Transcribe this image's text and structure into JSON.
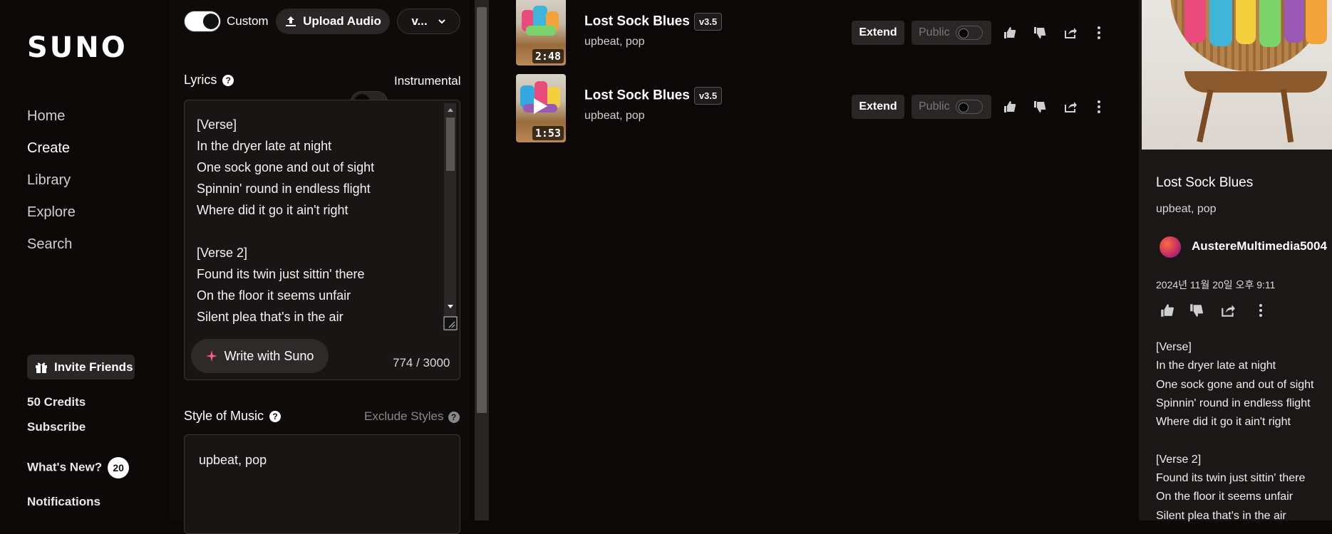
{
  "sidebar": {
    "logo": "SUNO",
    "nav": [
      "Home",
      "Create",
      "Library",
      "Explore",
      "Search"
    ],
    "invite_label": "Invite Friends",
    "credits": "50 Credits",
    "subscribe": "Subscribe",
    "whats_new": "What's New?",
    "whats_new_count": "20",
    "notifications": "Notifications"
  },
  "create": {
    "custom_label": "Custom",
    "upload_label": "Upload Audio",
    "version_label": "v...",
    "lyrics_label": "Lyrics",
    "instrumental_label": "Instrumental",
    "lyrics_text": "[Verse]\nIn the dryer late at night\nOne sock gone and out of sight\nSpinnin' round in endless flight\nWhere did it go it ain't right\n\n[Verse 2]\nFound its twin just sittin' there\nOn the floor it seems unfair\nSilent plea that's in the air",
    "write_label": "Write with Suno",
    "counter": "774 / 3000",
    "style_label": "Style of Music",
    "exclude_label": "Exclude Styles",
    "style_value": "upbeat, pop"
  },
  "songs": [
    {
      "title": "Lost Sock Blues",
      "version": "v3.5",
      "tags": "upbeat, pop",
      "duration": "2:48",
      "extend": "Extend",
      "public": "Public"
    },
    {
      "title": "Lost Sock Blues",
      "version": "v3.5",
      "tags": "upbeat, pop",
      "duration": "1:53",
      "extend": "Extend",
      "public": "Public"
    }
  ],
  "detail": {
    "title": "Lost Sock Blues",
    "tags": "upbeat,  pop",
    "user": "AustereMultimedia5004",
    "date": "2024년 11월 20일 오후 9:11",
    "lyrics": "[Verse]\nIn the dryer late at night\nOne sock gone and out of sight\nSpinnin' round in endless flight\nWhere did it go it ain't right\n\n[Verse 2]\nFound its twin just sittin' there\nOn the floor it seems unfair\nSilent plea that's in the air"
  },
  "colors": {
    "background": "#0d0808",
    "panel": "#1b1717",
    "button": "#2b2626",
    "accent_sparkle": "#ff5c8a"
  }
}
